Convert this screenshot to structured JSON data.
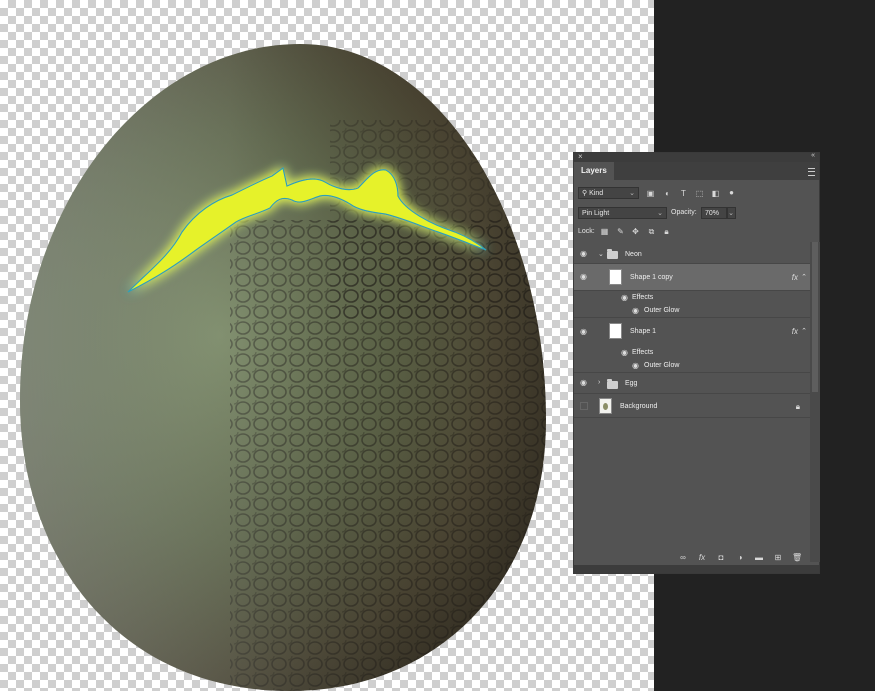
{
  "panel": {
    "close_glyph": "×",
    "collapse_glyph": "«",
    "tab_label": "Layers",
    "filter": {
      "kind_label": "Kind",
      "search_glyph": "⚲",
      "chevron": "⌄"
    },
    "blend_mode": "Pin Light",
    "opacity_label": "Opacity:",
    "opacity_value": "70%",
    "opacity_slider_fraction": 0.7,
    "lock_label": "Lock:",
    "layers": [
      {
        "name": "Neon",
        "type": "group",
        "visible": true,
        "expanded": true
      },
      {
        "name": "Shape 1 copy",
        "type": "shape",
        "visible": true,
        "selected": true,
        "fx": "fx",
        "effects_label": "Effects",
        "effect_name": "Outer Glow"
      },
      {
        "name": "Shape 1",
        "type": "shape",
        "visible": true,
        "fx": "fx",
        "effects_label": "Effects",
        "effect_name": "Outer Glow"
      },
      {
        "name": "Egg",
        "type": "group",
        "visible": true,
        "expanded": false
      },
      {
        "name": "Background",
        "type": "pixel",
        "visible": false,
        "locked": true
      }
    ],
    "bottom_icons": [
      "link-icon",
      "fx-icon",
      "mask-icon",
      "adjustment-icon",
      "new-group-icon",
      "new-layer-icon",
      "trash-icon"
    ],
    "bottom_fx_label": "fx"
  },
  "colors": {
    "neon_fill": "#e6f22a",
    "neon_glow": "#b8ff3c",
    "neon_stroke": "#2fa0b8",
    "panel_bg": "#535353"
  }
}
